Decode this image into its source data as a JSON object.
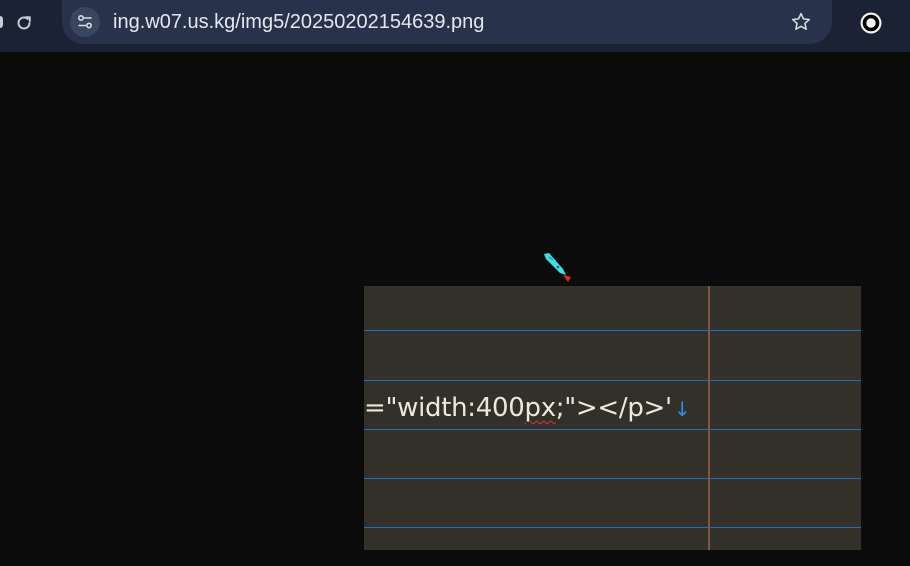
{
  "browser": {
    "url": "ing.w07.us.kg/img5/20250202154639.png",
    "colors": {
      "toolbar": "#1a2233",
      "omnibox": "#28324a",
      "page_background": "#0b0b0b"
    }
  },
  "editor": {
    "line_text_parts": [
      "=\"width:400",
      "px",
      ";\"></p>'"
    ],
    "end_of_line_marker": "↓",
    "colors": {
      "background": "#33302a",
      "guide_lines": "#1f6fc2",
      "margin_line": "#7a5a44",
      "spell_error": "#dd3333"
    }
  },
  "icons": {
    "reload": "reload-icon",
    "site_info": "tune-icon",
    "bookmark": "star-icon",
    "extension": "ring-icon",
    "cursor": "pen-cursor-icon"
  }
}
